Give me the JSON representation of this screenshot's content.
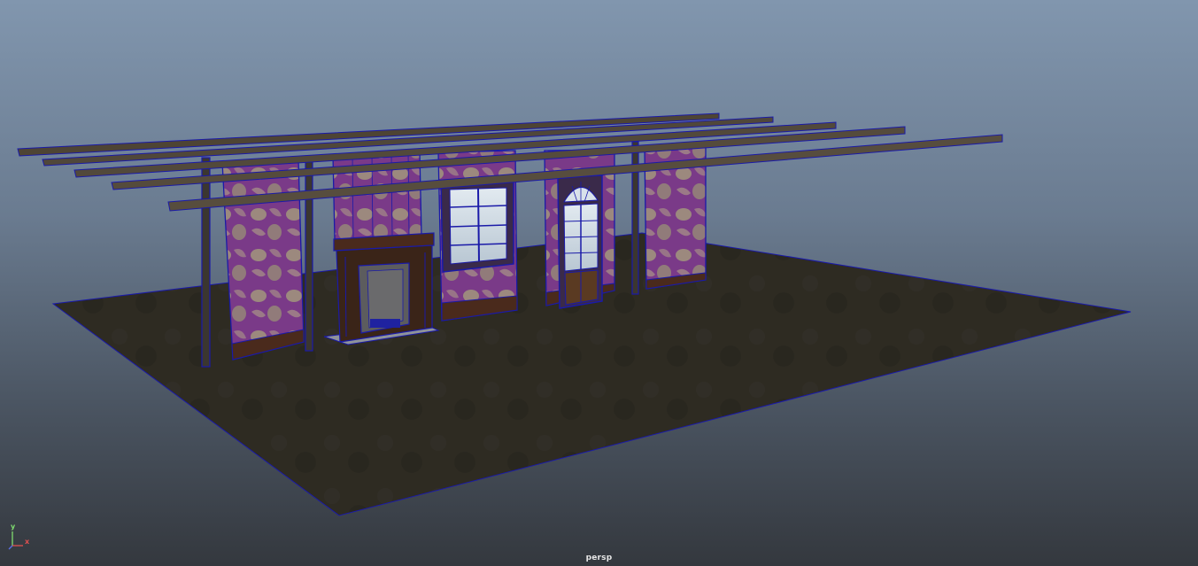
{
  "viewport": {
    "camera_label": "persp",
    "axis": {
      "y_label": "y",
      "x_label": "x"
    },
    "colors": {
      "background_top": "#8196ae",
      "background_bottom": "#34383e",
      "floor": "#2d2a22",
      "wireframe": "#1a1aa8",
      "wallpaper": "#7a3a88",
      "wood": "#4e4434"
    }
  },
  "scene": {
    "objects": [
      "floor-plane",
      "wall-panel",
      "ceiling-beam",
      "fireplace",
      "window",
      "french-door",
      "wooden-post"
    ]
  }
}
